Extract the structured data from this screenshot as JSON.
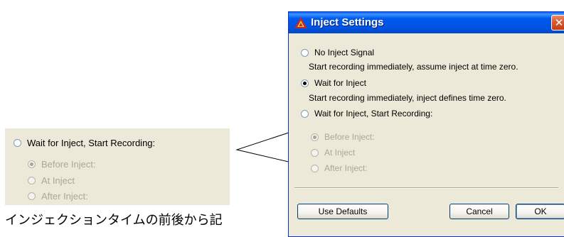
{
  "zoom": {
    "main_option": "Wait for Inject, Start Recording:",
    "sub_options": [
      "Before Inject:",
      "At Inject",
      "After Inject:"
    ]
  },
  "caption": "インジェクションタイムの前後から記",
  "dialog": {
    "title": "Inject Settings",
    "close_glyph": "✕",
    "options": [
      {
        "label": "No Inject Signal",
        "description": "Start recording immediately, assume inject at time zero.",
        "checked": false
      },
      {
        "label": "Wait for Inject",
        "description": "Start recording immediately, inject defines time zero.",
        "checked": true
      },
      {
        "label": "Wait for Inject, Start Recording:",
        "description": "",
        "checked": false
      }
    ],
    "sub_options": [
      {
        "label": "Before Inject:",
        "checked": true,
        "enabled": false
      },
      {
        "label": "At Inject",
        "checked": false,
        "enabled": false
      },
      {
        "label": "After Inject:",
        "checked": false,
        "enabled": false
      }
    ],
    "buttons": {
      "defaults": "Use Defaults",
      "cancel": "Cancel",
      "ok": "OK"
    }
  },
  "colors": {
    "dialog_face": "#ece9d8",
    "titlebar_blue": "#0054e3",
    "close_red": "#d8552f",
    "disabled_text": "#aca899"
  }
}
